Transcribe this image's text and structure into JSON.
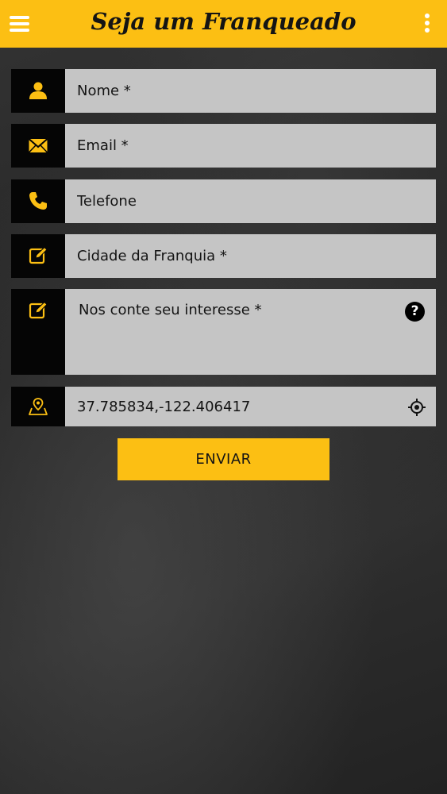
{
  "header": {
    "title": "Seja um Franqueado",
    "menu_icon": "hamburger-icon",
    "more_icon": "more-vertical-icon"
  },
  "form": {
    "name_placeholder": "Nome *",
    "email_placeholder": "Email *",
    "phone_placeholder": "Telefone",
    "city_placeholder": "Cidade da Franquia *",
    "interest_placeholder": "Nos conte seu interesse *",
    "help_glyph": "?",
    "location_value": "37.785834,-122.406417",
    "submit_label": "ENVIAR"
  },
  "colors": {
    "accent": "#fcbf13",
    "field_bg": "#c5c5c5",
    "icon_bg": "#050505"
  }
}
